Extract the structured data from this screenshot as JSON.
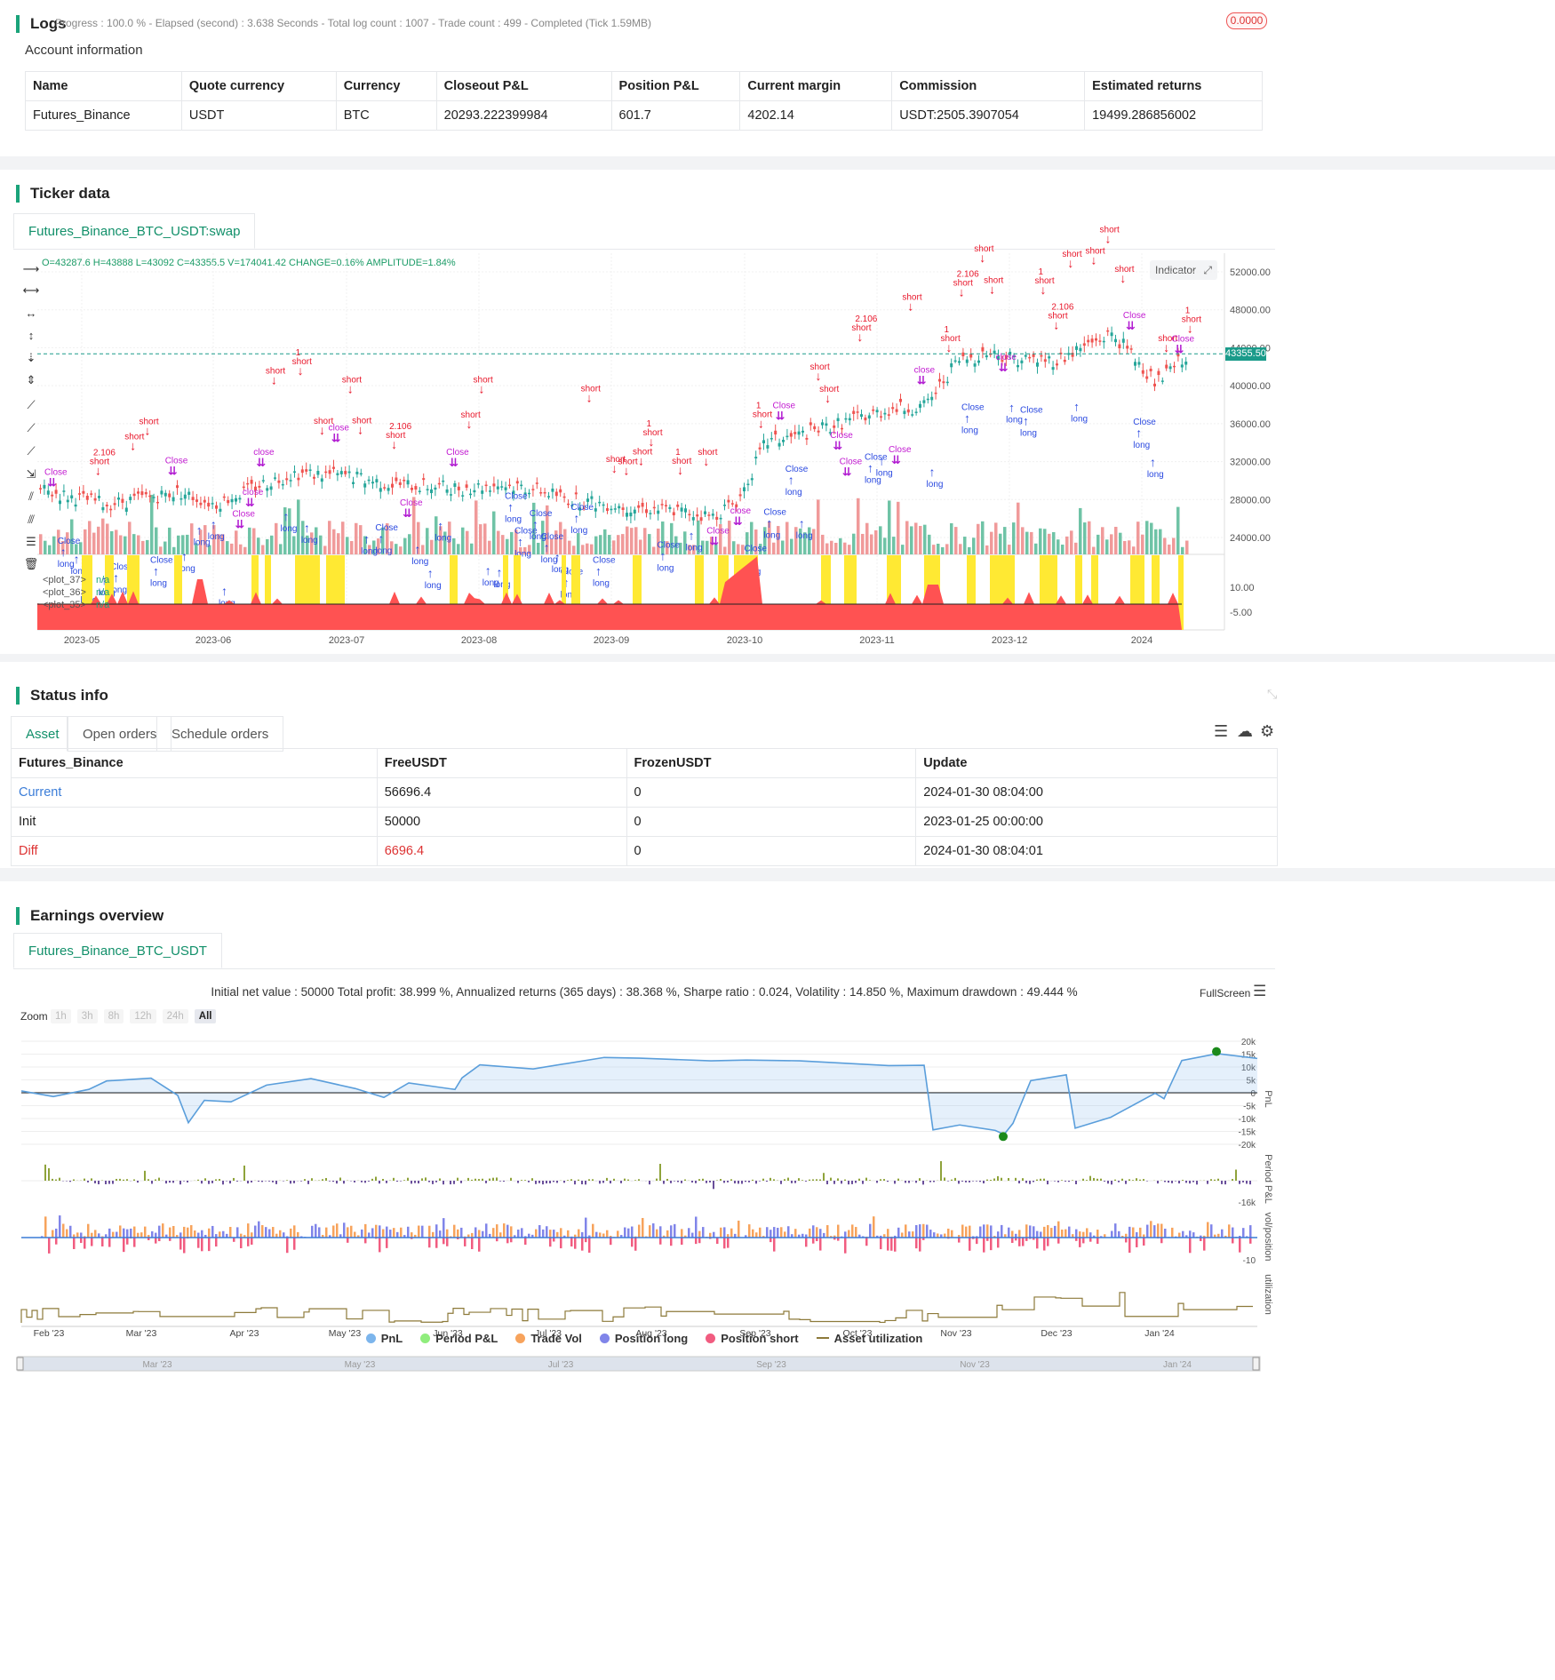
{
  "logs": {
    "title": "Logs",
    "status": "Progress : 100.0 % - Elapsed (second) : 3.638 Seconds - Total log count : 1007 - Trade count : 499 - Completed (Tick 1.59MB)",
    "badge": "0.0000"
  },
  "account": {
    "title": "Account information",
    "headers": [
      "Name",
      "Quote currency",
      "Currency",
      "Closeout P&L",
      "Position P&L",
      "Current margin",
      "Commission",
      "Estimated returns"
    ],
    "row": [
      "Futures_Binance",
      "USDT",
      "BTC",
      "20293.222399984",
      "601.7",
      "4202.14",
      "USDT:2505.3907054",
      "19499.286856002"
    ]
  },
  "ticker": {
    "title": "Ticker data",
    "tab": "Futures_Binance_BTC_USDT:swap",
    "ohlc": "O=43287.6 H=43888 L=43092 C=43355.5 V=174041.42 CHANGE=0.16% AMPLITUDE=1.84%",
    "indicator_btn": "Indicator",
    "price_tag": "43355.50",
    "price_ticks": [
      "52000.00",
      "48000.00",
      "44000.00",
      "40000.00",
      "36000.00",
      "32000.00",
      "28000.00",
      "24000.00"
    ],
    "ind_ticks": [
      "10.00",
      "-5.00"
    ],
    "date_ticks": [
      "2023-05",
      "2023-06",
      "2023-07",
      "2023-08",
      "2023-09",
      "2023-10",
      "2023-11",
      "2023-12",
      "2024"
    ],
    "plots": [
      {
        "name": "<plot_37>",
        "val": "n/a"
      },
      {
        "name": "<plot_36>",
        "val": "n/a"
      },
      {
        "name": "<plot_35>",
        "val": "n/a"
      }
    ],
    "labels": {
      "short": "short",
      "long": "long",
      "close": "close",
      "close_cap": "Close",
      "one": "1",
      "qty": "2.106"
    }
  },
  "status": {
    "title": "Status info",
    "tabs": [
      "Asset",
      "Open orders",
      "Schedule orders"
    ],
    "headers": [
      "Futures_Binance",
      "FreeUSDT",
      "FrozenUSDT",
      "Update"
    ],
    "rows": [
      [
        "Current",
        "56696.4",
        "0",
        "2024-01-30 08:04:00"
      ],
      [
        "Init",
        "50000",
        "0",
        "2023-01-25 00:00:00"
      ],
      [
        "Diff",
        "6696.4",
        "0",
        "2024-01-30 08:04:01"
      ]
    ]
  },
  "earnings": {
    "title": "Earnings overview",
    "tab": "Futures_Binance_BTC_USDT",
    "summary": "Initial net value : 50000 Total profit: 38.999 %, Annualized returns (365 days) : 38.368 %, Sharpe ratio : 0.024, Volatility : 14.850 %, Maximum drawdown : 49.444 %",
    "fullscreen": "FullScreen",
    "zoom_label": "Zoom",
    "zoom_opts": [
      "1h",
      "3h",
      "8h",
      "12h",
      "24h",
      "All"
    ],
    "pnl_ticks": [
      "20k",
      "15k",
      "10k",
      "5k",
      "0",
      "-5k",
      "-10k",
      "-15k",
      "-20k"
    ],
    "period_tick": "-16k",
    "vol_tick": "-10",
    "axis_labels": [
      "PnL",
      "Period P&L",
      "vol/position",
      "utilization"
    ],
    "months": [
      "Feb '23",
      "Mar '23",
      "Apr '23",
      "May '23",
      "Jun '23",
      "Jul '23",
      "Aug '23",
      "Sep '23",
      "Oct '23",
      "Nov '23",
      "Dec '23",
      "Jan '24"
    ],
    "nav_months": [
      "Mar '23",
      "May '23",
      "Jul '23",
      "Sep '23",
      "Nov '23",
      "Jan '24"
    ],
    "legend": [
      {
        "name": "PnL",
        "color": "#7cb5ec"
      },
      {
        "name": "Period P&L",
        "color": "#90ed7d"
      },
      {
        "name": "Trade Vol",
        "color": "#f7a35c"
      },
      {
        "name": "Position long",
        "color": "#8085e9"
      },
      {
        "name": "Position short",
        "color": "#f15c80"
      },
      {
        "name": "Asset utilization",
        "color": "#8d7a3a"
      }
    ]
  }
}
